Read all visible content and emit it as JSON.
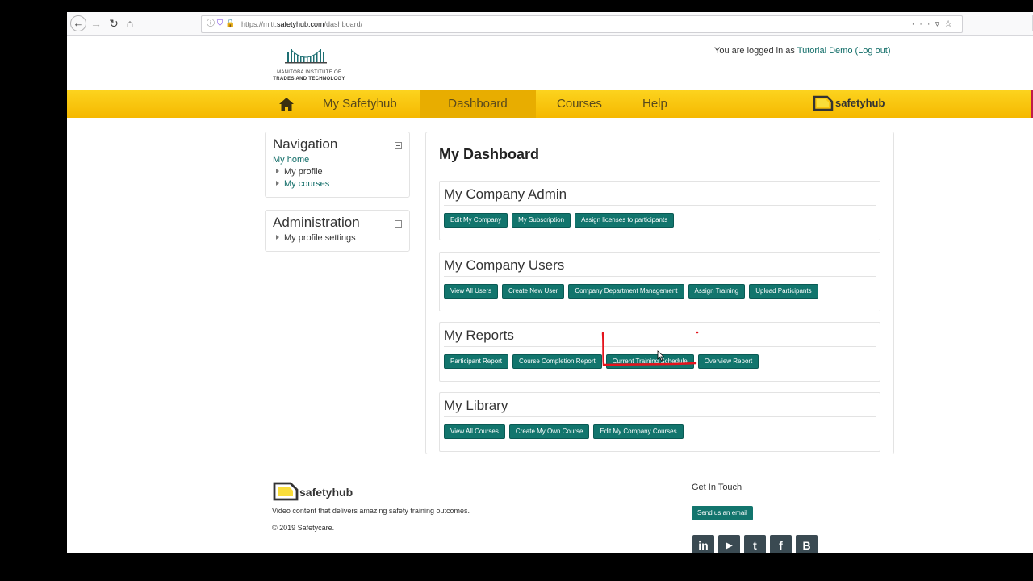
{
  "browser": {
    "url_prefix": "https://mitt.",
    "url_host": "safetyhub.com",
    "url_path": "/dashboard/",
    "menu_icon": "more-icon",
    "pocket_icon": "pocket-icon",
    "bookmark_icon": "star-icon"
  },
  "header": {
    "logo_line1": "MANITOBA INSTITUTE OF",
    "logo_line2": "TRADES AND TECHNOLOGY",
    "login_prefix": "You are logged in as ",
    "user_name": "Tutorial Demo",
    "logout_label": "(Log out)"
  },
  "navbar": {
    "items": [
      {
        "label": "My Safetyhub"
      },
      {
        "label": "Dashboard"
      },
      {
        "label": "Courses"
      },
      {
        "label": "Help"
      }
    ],
    "brand": "safetyhub",
    "colors": {
      "bar": "#f5b800",
      "active": "#e8ad00",
      "button": "#12756d"
    }
  },
  "sidebar": {
    "navigation": {
      "title": "Navigation",
      "home": "My home",
      "profile": "My profile",
      "courses": "My courses"
    },
    "administration": {
      "title": "Administration",
      "profile_settings": "My profile settings"
    }
  },
  "main": {
    "title": "My Dashboard",
    "sections": [
      {
        "title": "My Company Admin",
        "buttons": [
          "Edit My Company",
          "My Subscription",
          "Assign licenses to participants"
        ]
      },
      {
        "title": "My Company Users",
        "buttons": [
          "View All Users",
          "Create New User",
          "Company Department Management",
          "Assign Training",
          "Upload Participants"
        ]
      },
      {
        "title": "My Reports",
        "buttons": [
          "Participant Report",
          "Course Completion Report",
          "Current Training Schedule",
          "Overview Report"
        ]
      },
      {
        "title": "My Library",
        "buttons": [
          "View All Courses",
          "Create My Own Course",
          "Edit My Company Courses"
        ]
      }
    ]
  },
  "footer": {
    "brand": "safetyhub",
    "tagline": "Video content that delivers amazing safety training outcomes.",
    "copyright": "© 2019 Safetycare.",
    "contact_title": "Get In Touch",
    "email_button": "Send us an email",
    "social": [
      {
        "icon": "linkedin-icon",
        "glyph": "in"
      },
      {
        "icon": "youtube-icon",
        "glyph": "▶"
      },
      {
        "icon": "twitter-icon",
        "glyph": "t"
      },
      {
        "icon": "facebook-icon",
        "glyph": "f"
      },
      {
        "icon": "blogger-icon",
        "glyph": "B"
      }
    ]
  }
}
